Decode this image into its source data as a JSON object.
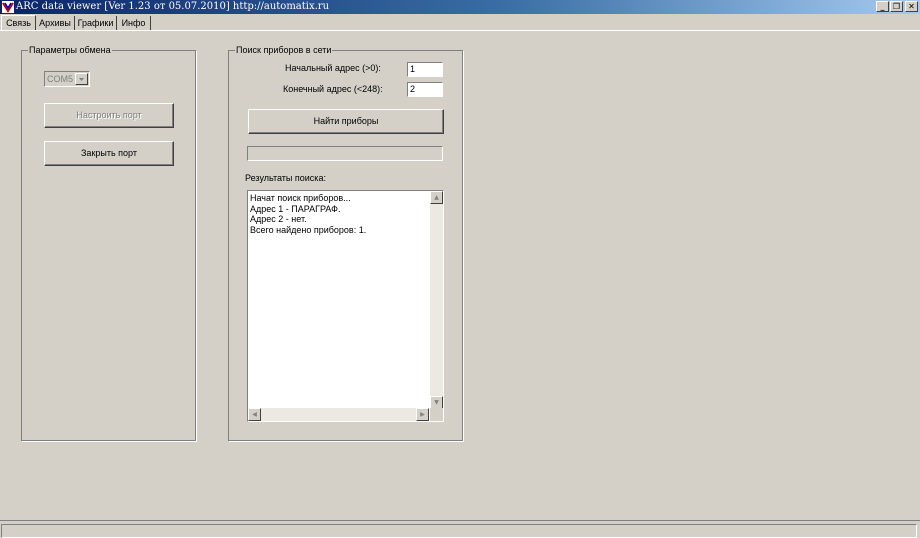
{
  "window": {
    "title": "ARC data viewer [Ver 1.23 от 05.07.2010]   http://automatix.ru",
    "minimize_glyph": "_",
    "restore_glyph": "❐",
    "close_glyph": "✕"
  },
  "tabs": [
    {
      "label": "Связь",
      "active": true
    },
    {
      "label": "Архивы",
      "active": false
    },
    {
      "label": "Графики",
      "active": false
    },
    {
      "label": "Инфо",
      "active": false
    }
  ],
  "exchange": {
    "legend": "Параметры обмена",
    "port_value": "COM5",
    "configure_label": "Настроить порт",
    "close_port_label": "Закрыть порт"
  },
  "search": {
    "legend": "Поиск приборов в сети",
    "start_label": "Начальный адрес (>0):",
    "start_value": "1",
    "end_label": "Конечный адрес (<248):",
    "end_value": "2",
    "find_label": "Найти приборы",
    "progress": 0,
    "results_label": "Результаты поиска:",
    "results": [
      "Начат поиск приборов...",
      "Адрес 1 - ПАРАГРАФ.",
      "Адрес 2 - нет.",
      "Всего найдено приборов: 1."
    ]
  },
  "icons": {
    "app": "app-icon",
    "scroll_up": "▲",
    "scroll_down": "▼",
    "scroll_left": "◀",
    "scroll_right": "▶"
  }
}
